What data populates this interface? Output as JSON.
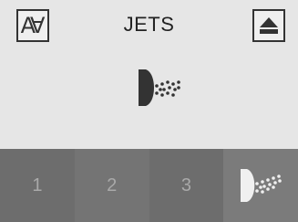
{
  "header": {
    "title": "JETS",
    "font_button_icon": "font-size-icon",
    "eject_button_icon": "eject-icon"
  },
  "mode": {
    "icon": "spray-nozzle-icon"
  },
  "jet_buttons": [
    {
      "label": "1"
    },
    {
      "label": "2"
    },
    {
      "label": "3"
    },
    {
      "label": "",
      "icon": "spray-nozzle-icon"
    }
  ],
  "colors": {
    "background": "#e6e6e6",
    "button_bar": "#6d6d6d",
    "icon_dark": "#333333",
    "icon_light": "#f0f0f0"
  }
}
